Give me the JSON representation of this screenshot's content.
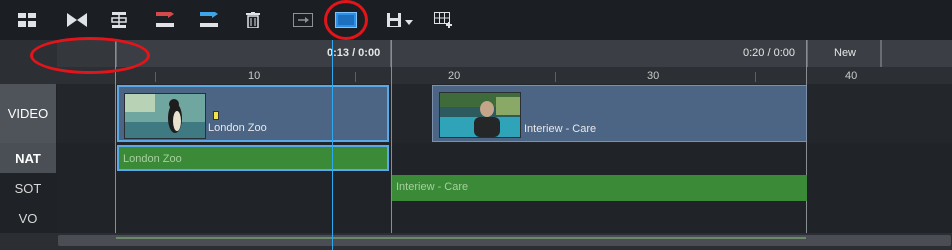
{
  "toolbar": {
    "icons": [
      "layout-icon",
      "bowtie-icon",
      "film-strip-icon",
      "move-left-red-icon",
      "move-right-blue-icon",
      "trash-icon",
      "export-icon",
      "fit-timeline-icon",
      "save-dropdown-icon",
      "add-grid-icon"
    ]
  },
  "ruler": {
    "segment_1_time": "0:13 / 0:00",
    "segment_2_time": "0:20 / 0:00",
    "segment_3_label": "New",
    "ticks": [
      "10",
      "20",
      "30",
      "40"
    ]
  },
  "tracks": {
    "video": "VIDEO",
    "nat": "NAT",
    "sot": "SOT",
    "vo": "VO"
  },
  "clips": {
    "video_1": "London Zoo",
    "video_2": "Interiew - Care",
    "nat_1": "London Zoo",
    "sot_1": "Interiew - Care"
  },
  "colors": {
    "accent_blue": "#2e8fe6",
    "annotation_red": "#e3141a",
    "audio_green": "#3a8a37",
    "video_blue": "#4d6585"
  }
}
